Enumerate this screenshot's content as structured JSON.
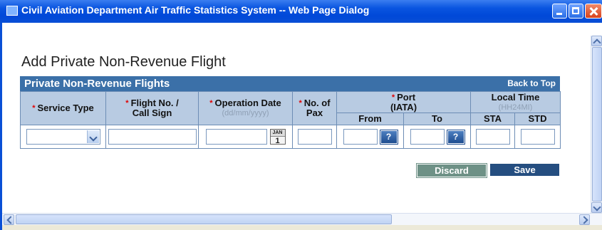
{
  "window": {
    "title": "Civil Aviation Department Air Traffic Statistics System -- Web Page Dialog"
  },
  "page": {
    "title": "Add Private Non-Revenue Flight"
  },
  "section": {
    "title": "Private Non-Revenue Flights",
    "back_to_top": "Back to Top"
  },
  "table": {
    "required_mark": "*",
    "headers": {
      "service_type": "Service Type",
      "flight_no": "Flight No. /",
      "flight_no_2": "Call Sign",
      "operation_date": "Operation Date",
      "operation_date_hint": "(dd/mm/yyyy)",
      "no_of_pax": "No. of",
      "no_of_pax_2": "Pax",
      "port": "Port",
      "port_2": "(IATA)",
      "port_from": "From",
      "port_to": "To",
      "local_time": "Local Time",
      "local_time_hint": "(HH24MI)",
      "sta": "STA",
      "std": "STD"
    },
    "row": {
      "service_type": "",
      "flight_no": "",
      "operation_date": "",
      "no_of_pax": "",
      "port_from": "",
      "port_to": "",
      "sta": "",
      "std": ""
    },
    "calendar_icon": {
      "month": "JAN",
      "day": "1"
    },
    "lookup_button_label": "?"
  },
  "actions": {
    "discard": "Discard",
    "save": "Save"
  },
  "colors": {
    "titlebar": "#0a55e0",
    "section_bar": "#3b70a8",
    "header_bg": "#b8cbe2",
    "required": "#e00000",
    "discard_bg": "#6e9186",
    "save_bg": "#254e80"
  }
}
